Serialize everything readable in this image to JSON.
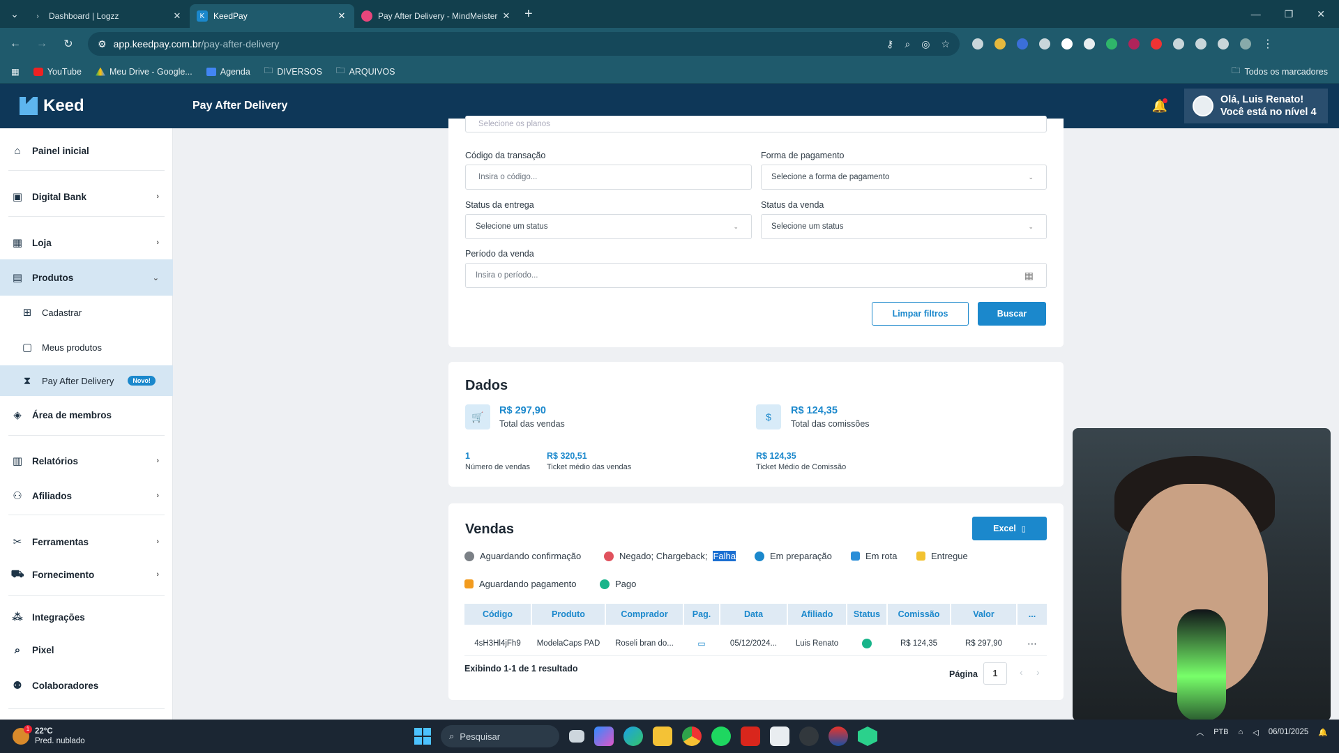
{
  "browser": {
    "tabs": [
      {
        "title": "Dashboard | Logzz",
        "active": false
      },
      {
        "title": "KeedPay",
        "active": true
      },
      {
        "title": "Pay After Delivery - MindMeister",
        "active": false
      }
    ],
    "url_host": "app.keedpay.com.br",
    "url_path": "/pay-after-delivery",
    "bookmarks": [
      "YouTube",
      "Meu Drive - Google...",
      "Agenda",
      "DIVERSOS",
      "ARQUIVOS"
    ],
    "bookmarks_right": "Todos os marcadores"
  },
  "app": {
    "logo": "Keed",
    "page_title": "Pay After Delivery",
    "user_greeting_1": "Olá, Luis Renato!",
    "user_greeting_2": "Você está no nível 4"
  },
  "sidebar": {
    "items": [
      {
        "label": "Painel inicial",
        "icon": "home-icon"
      },
      {
        "label": "Digital Bank",
        "icon": "bank-icon"
      },
      {
        "label": "Loja",
        "icon": "store-icon"
      },
      {
        "label": "Produtos",
        "icon": "products-icon"
      },
      {
        "label": "Cadastrar",
        "icon": "add-icon"
      },
      {
        "label": "Meus produtos",
        "icon": "box-icon"
      },
      {
        "label": "Pay After Delivery",
        "icon": "hourglass-icon",
        "badge": "Novo!"
      },
      {
        "label": "Área de membros",
        "icon": "members-icon"
      },
      {
        "label": "Relatórios",
        "icon": "reports-icon"
      },
      {
        "label": "Afiliados",
        "icon": "affiliates-icon"
      },
      {
        "label": "Ferramentas",
        "icon": "tools-icon"
      },
      {
        "label": "Fornecimento",
        "icon": "supply-icon"
      },
      {
        "label": "Integrações",
        "icon": "integrations-icon"
      },
      {
        "label": "Pixel",
        "icon": "search-icon"
      },
      {
        "label": "Colaboradores",
        "icon": "team-icon"
      }
    ]
  },
  "filters": {
    "plans_placeholder": "Selecione os planos",
    "transaction_code_label": "Código da transação",
    "transaction_code_placeholder": "Insira o código...",
    "payment_method_label": "Forma de pagamento",
    "payment_method_placeholder": "Selecione a forma de pagamento",
    "delivery_status_label": "Status da entrega",
    "delivery_status_placeholder": "Selecione um status",
    "sale_status_label": "Status da venda",
    "sale_status_placeholder": "Selecione um status",
    "period_label": "Período da venda",
    "period_placeholder": "Insira o período...",
    "clear_button": "Limpar filtros",
    "search_button": "Buscar"
  },
  "dados": {
    "title": "Dados",
    "total_sales_value": "R$ 297,90",
    "total_sales_label": "Total das vendas",
    "total_commissions_value": "R$ 124,35",
    "total_commissions_label": "Total das comissões",
    "num_sales_value": "1",
    "num_sales_label": "Número de vendas",
    "avg_ticket_value": "R$ 320,51",
    "avg_ticket_label": "Ticket médio das vendas",
    "avg_commission_value": "R$ 124,35",
    "avg_commission_label": "Ticket Médio de Comissão"
  },
  "vendas": {
    "title": "Vendas",
    "excel_button": "Excel",
    "legend": [
      {
        "label": "Aguardando confirmação",
        "color": "#7b8086"
      },
      {
        "label": "Negado; Chargeback;",
        "highlight": "Falha",
        "color": "#e0525d"
      },
      {
        "label": "Em preparação",
        "color": "#1b88cc"
      },
      {
        "label": "Em rota",
        "color": "#2a8ed8"
      },
      {
        "label": "Entregue",
        "color": "#f2c230"
      },
      {
        "label": "Aguardando pagamento",
        "color": "#f29b1e"
      },
      {
        "label": "Pago",
        "color": "#18b48a"
      }
    ],
    "columns": [
      "Código",
      "Produto",
      "Comprador",
      "Pag.",
      "Data",
      "Afiliado",
      "Status",
      "Comissão",
      "Valor",
      "..."
    ],
    "rows": [
      {
        "codigo": "4sH3Hl4jFh9",
        "produto": "ModelaCaps PAD",
        "comprador": "Roseli bran do...",
        "data": "05/12/2024...",
        "afiliado": "Luis Renato",
        "comissao": "R$ 124,35",
        "valor": "R$ 297,90"
      }
    ],
    "result_text": "Exibindo 1-1 de 1 resultado",
    "page_label": "Página",
    "page_number": "1"
  },
  "taskbar": {
    "temp": "22°C",
    "weather": "Pred. nublado",
    "search": "Pesquisar",
    "lang": "PTB",
    "date": "06/01/2025"
  }
}
